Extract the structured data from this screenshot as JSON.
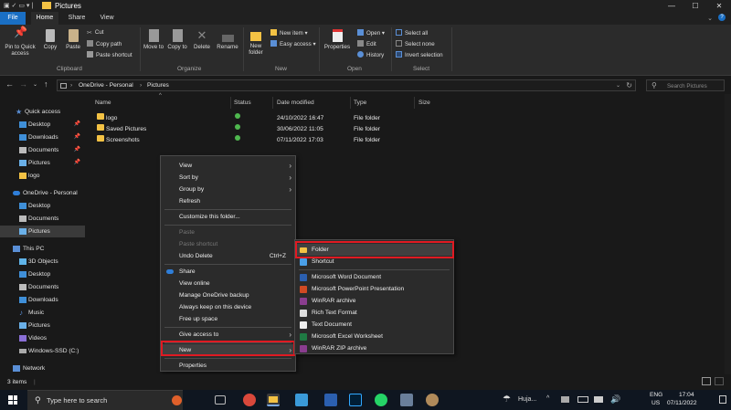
{
  "window": {
    "title": "Pictures"
  },
  "ribbon_tabs": [
    "File",
    "Home",
    "Share",
    "View"
  ],
  "ribbon": {
    "clipboard": {
      "pin_label": "Pin to Quick access",
      "copy": "Copy",
      "paste": "Paste",
      "cut": "Cut",
      "copy_path": "Copy path",
      "paste_shortcut": "Paste shortcut",
      "group": "Clipboard"
    },
    "organize": {
      "move_to": "Move to",
      "copy_to": "Copy to",
      "delete": "Delete",
      "rename": "Rename",
      "group": "Organize"
    },
    "new": {
      "new_folder": "New folder",
      "new_item": "New item",
      "easy_access": "Easy access",
      "group": "New"
    },
    "open": {
      "properties": "Properties",
      "open": "Open",
      "edit": "Edit",
      "history": "History",
      "group": "Open"
    },
    "select": {
      "select_all": "Select all",
      "select_none": "Select none",
      "invert": "Invert selection",
      "group": "Select"
    }
  },
  "address": {
    "path": [
      "OneDrive - Personal",
      "Pictures"
    ],
    "search_placeholder": "Search Pictures"
  },
  "nav": [
    {
      "label": "Quick access",
      "icon": "star-icon"
    },
    {
      "label": "Desktop",
      "icon": "desktop-icon",
      "pinned": true
    },
    {
      "label": "Downloads",
      "icon": "download-icon",
      "pinned": true
    },
    {
      "label": "Documents",
      "icon": "document-icon",
      "pinned": true
    },
    {
      "label": "Pictures",
      "icon": "pictures-icon",
      "pinned": true
    },
    {
      "label": "logo",
      "icon": "folder-icon"
    },
    {
      "label": "OneDrive - Personal",
      "icon": "cloud-icon"
    },
    {
      "label": "Desktop",
      "icon": "desktop-icon"
    },
    {
      "label": "Documents",
      "icon": "document-icon"
    },
    {
      "label": "Pictures",
      "icon": "pictures-icon",
      "selected": true
    },
    {
      "label": "This PC",
      "icon": "pc-icon"
    },
    {
      "label": "3D Objects",
      "icon": "cube-icon"
    },
    {
      "label": "Desktop",
      "icon": "desktop-icon"
    },
    {
      "label": "Documents",
      "icon": "document-icon"
    },
    {
      "label": "Downloads",
      "icon": "download-icon"
    },
    {
      "label": "Music",
      "icon": "music-icon"
    },
    {
      "label": "Pictures",
      "icon": "pictures-icon"
    },
    {
      "label": "Videos",
      "icon": "video-icon"
    },
    {
      "label": "Windows-SSD (C:)",
      "icon": "drive-icon"
    },
    {
      "label": "Network",
      "icon": "network-icon"
    }
  ],
  "columns": [
    "Name",
    "Status",
    "Date modified",
    "Type",
    "Size"
  ],
  "files": [
    {
      "name": "logo",
      "date": "24/10/2022 16:47",
      "type": "File folder"
    },
    {
      "name": "Saved Pictures",
      "date": "30/06/2022 11:05",
      "type": "File folder"
    },
    {
      "name": "Screenshots",
      "date": "07/11/2022 17:03",
      "type": "File folder"
    }
  ],
  "context_menu": {
    "items": [
      "View",
      "Sort by",
      "Group by",
      "Refresh",
      "Customize this folder...",
      "Paste",
      "Paste shortcut",
      "Undo Delete",
      "Share",
      "View online",
      "Manage OneDrive backup",
      "Always keep on this device",
      "Free up space",
      "Give access to",
      "New",
      "Properties"
    ],
    "undo_shortcut": "Ctrl+Z"
  },
  "new_submenu": [
    "Folder",
    "Shortcut",
    "Microsoft Word Document",
    "Microsoft PowerPoint Presentation",
    "WinRAR archive",
    "Rich Text Format",
    "Text Document",
    "Microsoft Excel Worksheet",
    "WinRAR ZIP archive"
  ],
  "status": {
    "items": "3 items"
  },
  "taskbar": {
    "search_placeholder": "Type here to search",
    "weather": "Huja...",
    "lang": "ENG",
    "region": "US",
    "time": "17:04",
    "date": "07/11/2022"
  },
  "colors": {
    "accent": "#1a6fc4",
    "highlight": "#e01a22",
    "folder": "#f3c244"
  }
}
